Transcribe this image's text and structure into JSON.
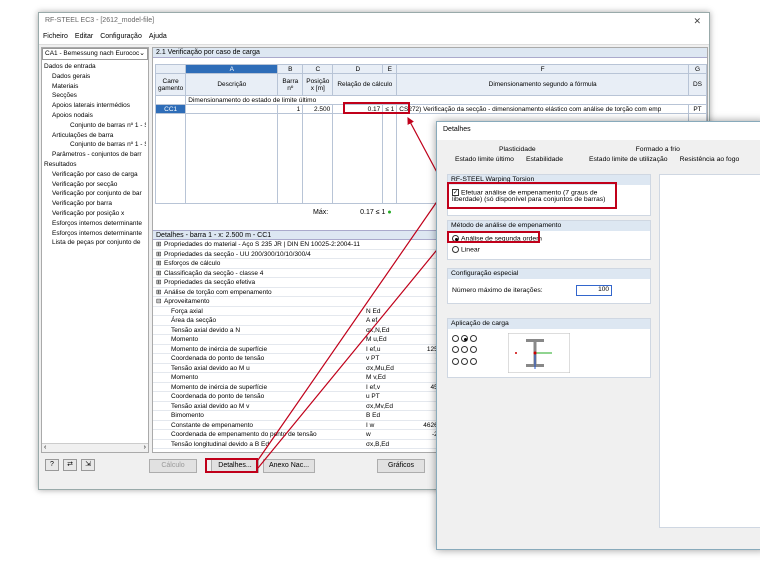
{
  "window": {
    "title": "RF-STEEL EC3 - [2612_model-file]",
    "menu": [
      "Ficheiro",
      "Editar",
      "Configuração",
      "Ajuda"
    ]
  },
  "left": {
    "case_select": "CA1 - Bemessung nach Eurococ",
    "tree": [
      {
        "label": "Dados de entrada",
        "level": 0
      },
      {
        "label": "Dados gerais",
        "level": 1
      },
      {
        "label": "Materiais",
        "level": 1
      },
      {
        "label": "Secções",
        "level": 1
      },
      {
        "label": "Apoios laterais intermédios",
        "level": 1
      },
      {
        "label": "Apoios nodais",
        "level": 1
      },
      {
        "label": "Conjunto de barras nº 1 - S",
        "level": 3
      },
      {
        "label": "Articulações de barra",
        "level": 1
      },
      {
        "label": "Conjunto de barras nº 1 - S",
        "level": 3
      },
      {
        "label": "Parâmetros - conjuntos de barr",
        "level": 1
      },
      {
        "label": "Resultados",
        "level": 0
      },
      {
        "label": "Verificação por caso de carga",
        "level": 1
      },
      {
        "label": "Verificação por secção",
        "level": 1
      },
      {
        "label": "Verificação por conjunto de bar",
        "level": 1
      },
      {
        "label": "Verificação por barra",
        "level": 1
      },
      {
        "label": "Verificação por posição x",
        "level": 1
      },
      {
        "label": "Esforços internos determinante",
        "level": 1
      },
      {
        "label": "Esforços internos determinante",
        "level": 1
      },
      {
        "label": "Lista de peças por conjunto de",
        "level": 1
      }
    ]
  },
  "main": {
    "section_title": "2.1 Verificação por caso de carga",
    "columns": {
      "letters": [
        "A",
        "B",
        "C",
        "D",
        "E",
        "F",
        "G"
      ],
      "carregamento": "Carre\ngamento",
      "descricao": "Descrição",
      "barra": "Barra nº",
      "posicao": "Posição x [m]",
      "relacao": "Relação de cálculo",
      "formula": "Dimensionamento segundo a fórmula",
      "ds": "DS"
    },
    "group_row": "Dimensionamento do estado de limite último",
    "row": {
      "case": "CC1",
      "member": "1",
      "position": "2.500",
      "ratio": "0.17",
      "le": "≤ 1",
      "formula": "CS272) Verificação da secção - dimensionamento elástico com análise de torção com emp",
      "ds": "PT"
    },
    "max_label": "Máx:",
    "max_value": "0.17",
    "max_le": "≤ 1"
  },
  "details": {
    "title": "Detalhes - barra 1 - x: 2.500 m - CC1",
    "rows": [
      {
        "label": "Propriedades do material - Aço S 235 JR | DIN EN 10025-2:2004-11",
        "type": "group"
      },
      {
        "label": "Propriedades da secção  -  UU 200/300/10/10/300/4",
        "type": "group"
      },
      {
        "label": "Esforços de cálculo",
        "type": "group"
      },
      {
        "label": "Classificação da secção - classe 4",
        "type": "group"
      },
      {
        "label": "Propriedades da secção efetiva",
        "type": "group"
      },
      {
        "label": "Análise de torção com empenamento",
        "type": "group"
      },
      {
        "label": "Aproveitamento",
        "type": "open"
      },
      {
        "label": "Força axial",
        "sym": "N Ed",
        "val": "0"
      },
      {
        "label": "Área da secção",
        "sym": "A ef",
        "val": "75"
      },
      {
        "label": "Tensão axial devido a N",
        "sym": "σx,N,Ed",
        "val": "0"
      },
      {
        "label": "Momento",
        "sym": "M u,Ed",
        "val": "10"
      },
      {
        "label": "Momento de inércia de superfície",
        "sym": "I ef,u",
        "val": "12506"
      },
      {
        "label": "Coordenada do ponto de tensão",
        "sym": "v PT",
        "val": "-12"
      },
      {
        "label": "Tensão axial devido ao M u",
        "sym": "σx,Mu,Ed",
        "val": "-1"
      },
      {
        "label": "Momento",
        "sym": "M v,Ed",
        "val": "4"
      },
      {
        "label": "Momento de inércia de superfície",
        "sym": "I ef,v",
        "val": "4502"
      },
      {
        "label": "Coordenada do ponto de tensão",
        "sym": "u PT",
        "val": "15"
      },
      {
        "label": "Tensão axial devido ao M v",
        "sym": "σx,Mv,Ed",
        "val": "-1"
      },
      {
        "label": "Bimomento",
        "sym": "B Ed",
        "val": "-0"
      },
      {
        "label": "Constante de empenamento",
        "sym": "I w",
        "val": "462667"
      },
      {
        "label": "Coordenada de empenamento do ponto de tensão",
        "sym": "w",
        "val": "-242"
      },
      {
        "label": "Tensão longitudinal devido a B Ed",
        "sym": "σx,B,Ed",
        "val": "-1"
      }
    ]
  },
  "buttons": {
    "calculo": "Cálculo",
    "detalhes": "Detalhes...",
    "anexo": "Anexo Nac...",
    "graficos": "Gráficos"
  },
  "dialog": {
    "title": "Detalhes",
    "tabs_top": [
      "Plasticidade",
      "Formado a frio"
    ],
    "tabs_bottom": [
      "Estado limite último",
      "Estabilidade",
      "Estado limite de utilização",
      "Resistência ao fogo"
    ],
    "warping": {
      "header": "RF-STEEL Warping Torsion",
      "checkbox_label": "Efetuar análise de empenamento (7 graus de liberdade) (só disponível para conjuntos de barras)",
      "checked": true
    },
    "method": {
      "header": "Método de análise de empenamento",
      "option1": "Análise de segunda ordem",
      "option2": "Linear",
      "selected": 1
    },
    "special": {
      "header": "Configuração especial",
      "max_iter_label": "Número máximo de iterações:",
      "max_iter_value": "100"
    },
    "load": {
      "header": "Aplicação de carga",
      "selected_index": 1
    }
  },
  "colors": {
    "highlight": "#c0001a",
    "selection": "#2e6db8",
    "header_bg": "#dde7f2"
  }
}
